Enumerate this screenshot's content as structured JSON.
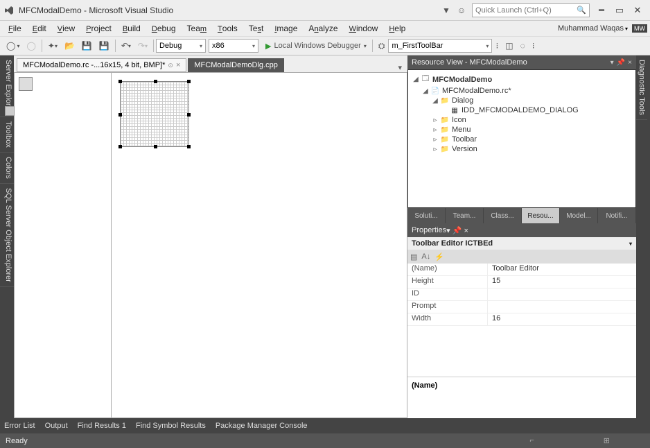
{
  "title": "MFCModalDemo - Microsoft Visual Studio",
  "quicklaunch_placeholder": "Quick Launch (Ctrl+Q)",
  "user": "Muhammad Waqas",
  "menu": [
    "File",
    "Edit",
    "View",
    "Project",
    "Build",
    "Debug",
    "Team",
    "Tools",
    "Test",
    "Image",
    "Analyze",
    "Window",
    "Help"
  ],
  "toolbar": {
    "config": "Debug",
    "platform": "x86",
    "run_label": "Local Windows Debugger",
    "right_field": "m_FirstToolBar"
  },
  "leftrail": [
    "Server Explorer",
    "Toolbox",
    "Colors",
    "SQL Server Object Explorer"
  ],
  "rightrail": [
    "Diagnostic Tools"
  ],
  "doctabs": [
    {
      "label": "MFCModalDemo.rc -...16x15, 4 bit, BMP]*",
      "active": true
    },
    {
      "label": "MFCModalDemoDlg.cpp",
      "active": false
    }
  ],
  "resource_view": {
    "title": "Resource View - MFCModalDemo",
    "root": "MFCModalDemo",
    "rc": "MFCModalDemo.rc*",
    "dialog_folder": "Dialog",
    "dialog_id": "IDD_MFCMODALDEMO_DIALOG",
    "folders": [
      "Icon",
      "Menu",
      "Toolbar",
      "Version"
    ]
  },
  "righttabs": [
    "Soluti...",
    "Team...",
    "Class...",
    "Resou...",
    "Model...",
    "Notifi..."
  ],
  "righttabs_active": 3,
  "properties": {
    "title": "Properties",
    "subtitle": "Toolbar Editor  ICTBEd",
    "rows": [
      {
        "name": "(Name)",
        "value": "Toolbar Editor"
      },
      {
        "name": "Height",
        "value": "15"
      },
      {
        "name": "ID",
        "value": ""
      },
      {
        "name": "Prompt",
        "value": ""
      },
      {
        "name": "Width",
        "value": "16"
      }
    ],
    "desc_title": "(Name)"
  },
  "bottomtabs": [
    "Error List",
    "Output",
    "Find Results 1",
    "Find Symbol Results",
    "Package Manager Console"
  ],
  "status": "Ready"
}
